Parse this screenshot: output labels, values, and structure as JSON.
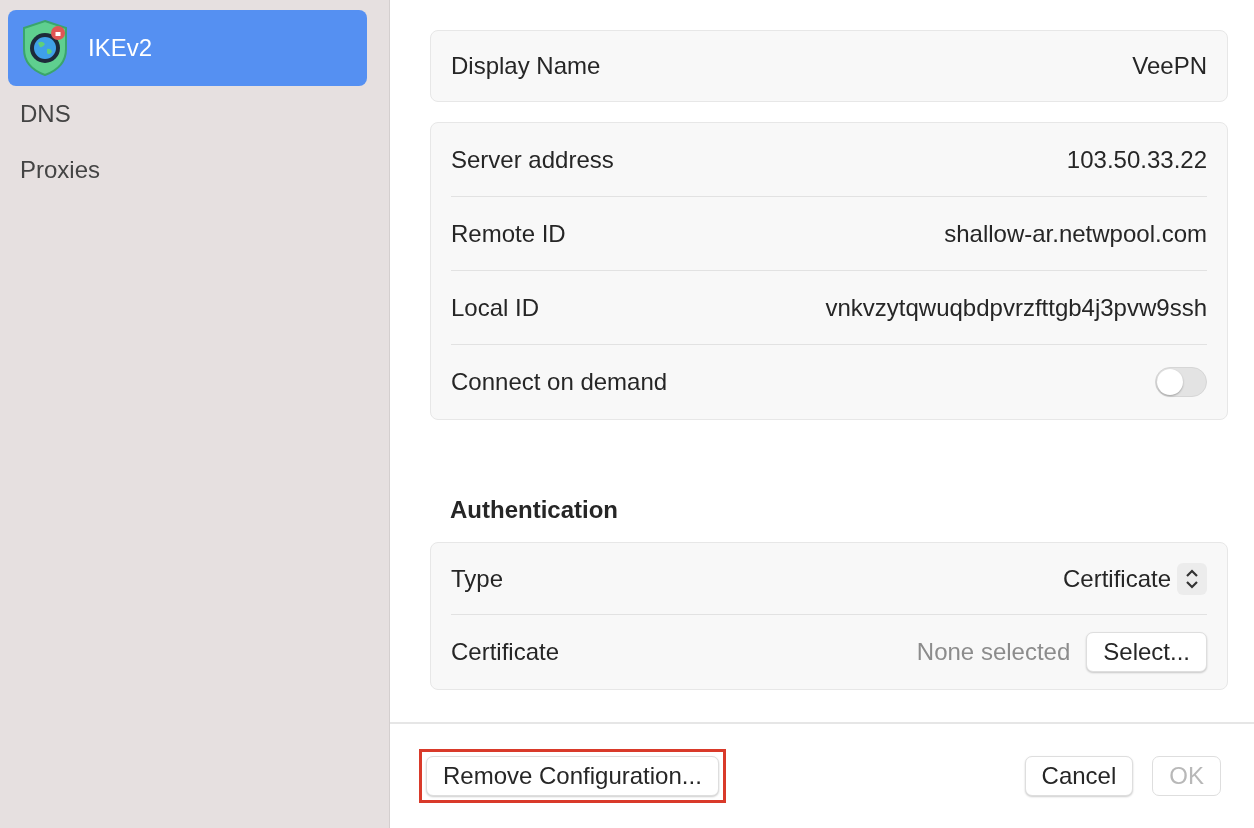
{
  "sidebar": {
    "items": [
      {
        "label": "IKEv2",
        "selected": true,
        "kind": "vpn"
      },
      {
        "label": "DNS",
        "selected": false,
        "kind": "plain"
      },
      {
        "label": "Proxies",
        "selected": false,
        "kind": "plain"
      }
    ]
  },
  "sections": [
    {
      "rows": [
        {
          "kind": "text",
          "label": "Display Name",
          "value": "VeePN"
        }
      ]
    },
    {
      "rows": [
        {
          "kind": "text",
          "label": "Server address",
          "value": "103.50.33.22"
        },
        {
          "kind": "text",
          "label": "Remote ID",
          "value": "shallow-ar.netwpool.com"
        },
        {
          "kind": "text",
          "label": "Local ID",
          "value": "vnkvzytqwuqbdpvrzfttgb4j3pvw9ssh"
        },
        {
          "kind": "toggle",
          "label": "Connect on demand",
          "on": false
        }
      ]
    },
    {
      "title": "Authentication",
      "rows": [
        {
          "kind": "popup",
          "label": "Type",
          "value": "Certificate"
        },
        {
          "kind": "picker",
          "label": "Certificate",
          "value": "None selected",
          "button": "Select..."
        }
      ]
    }
  ],
  "footer": {
    "left_buttons": [
      {
        "label": "Remove Configuration...",
        "disabled": false,
        "highlighted": true
      }
    ],
    "right_buttons": [
      {
        "label": "Cancel",
        "disabled": false,
        "highlighted": false
      },
      {
        "label": "OK",
        "disabled": true,
        "highlighted": false
      }
    ]
  }
}
